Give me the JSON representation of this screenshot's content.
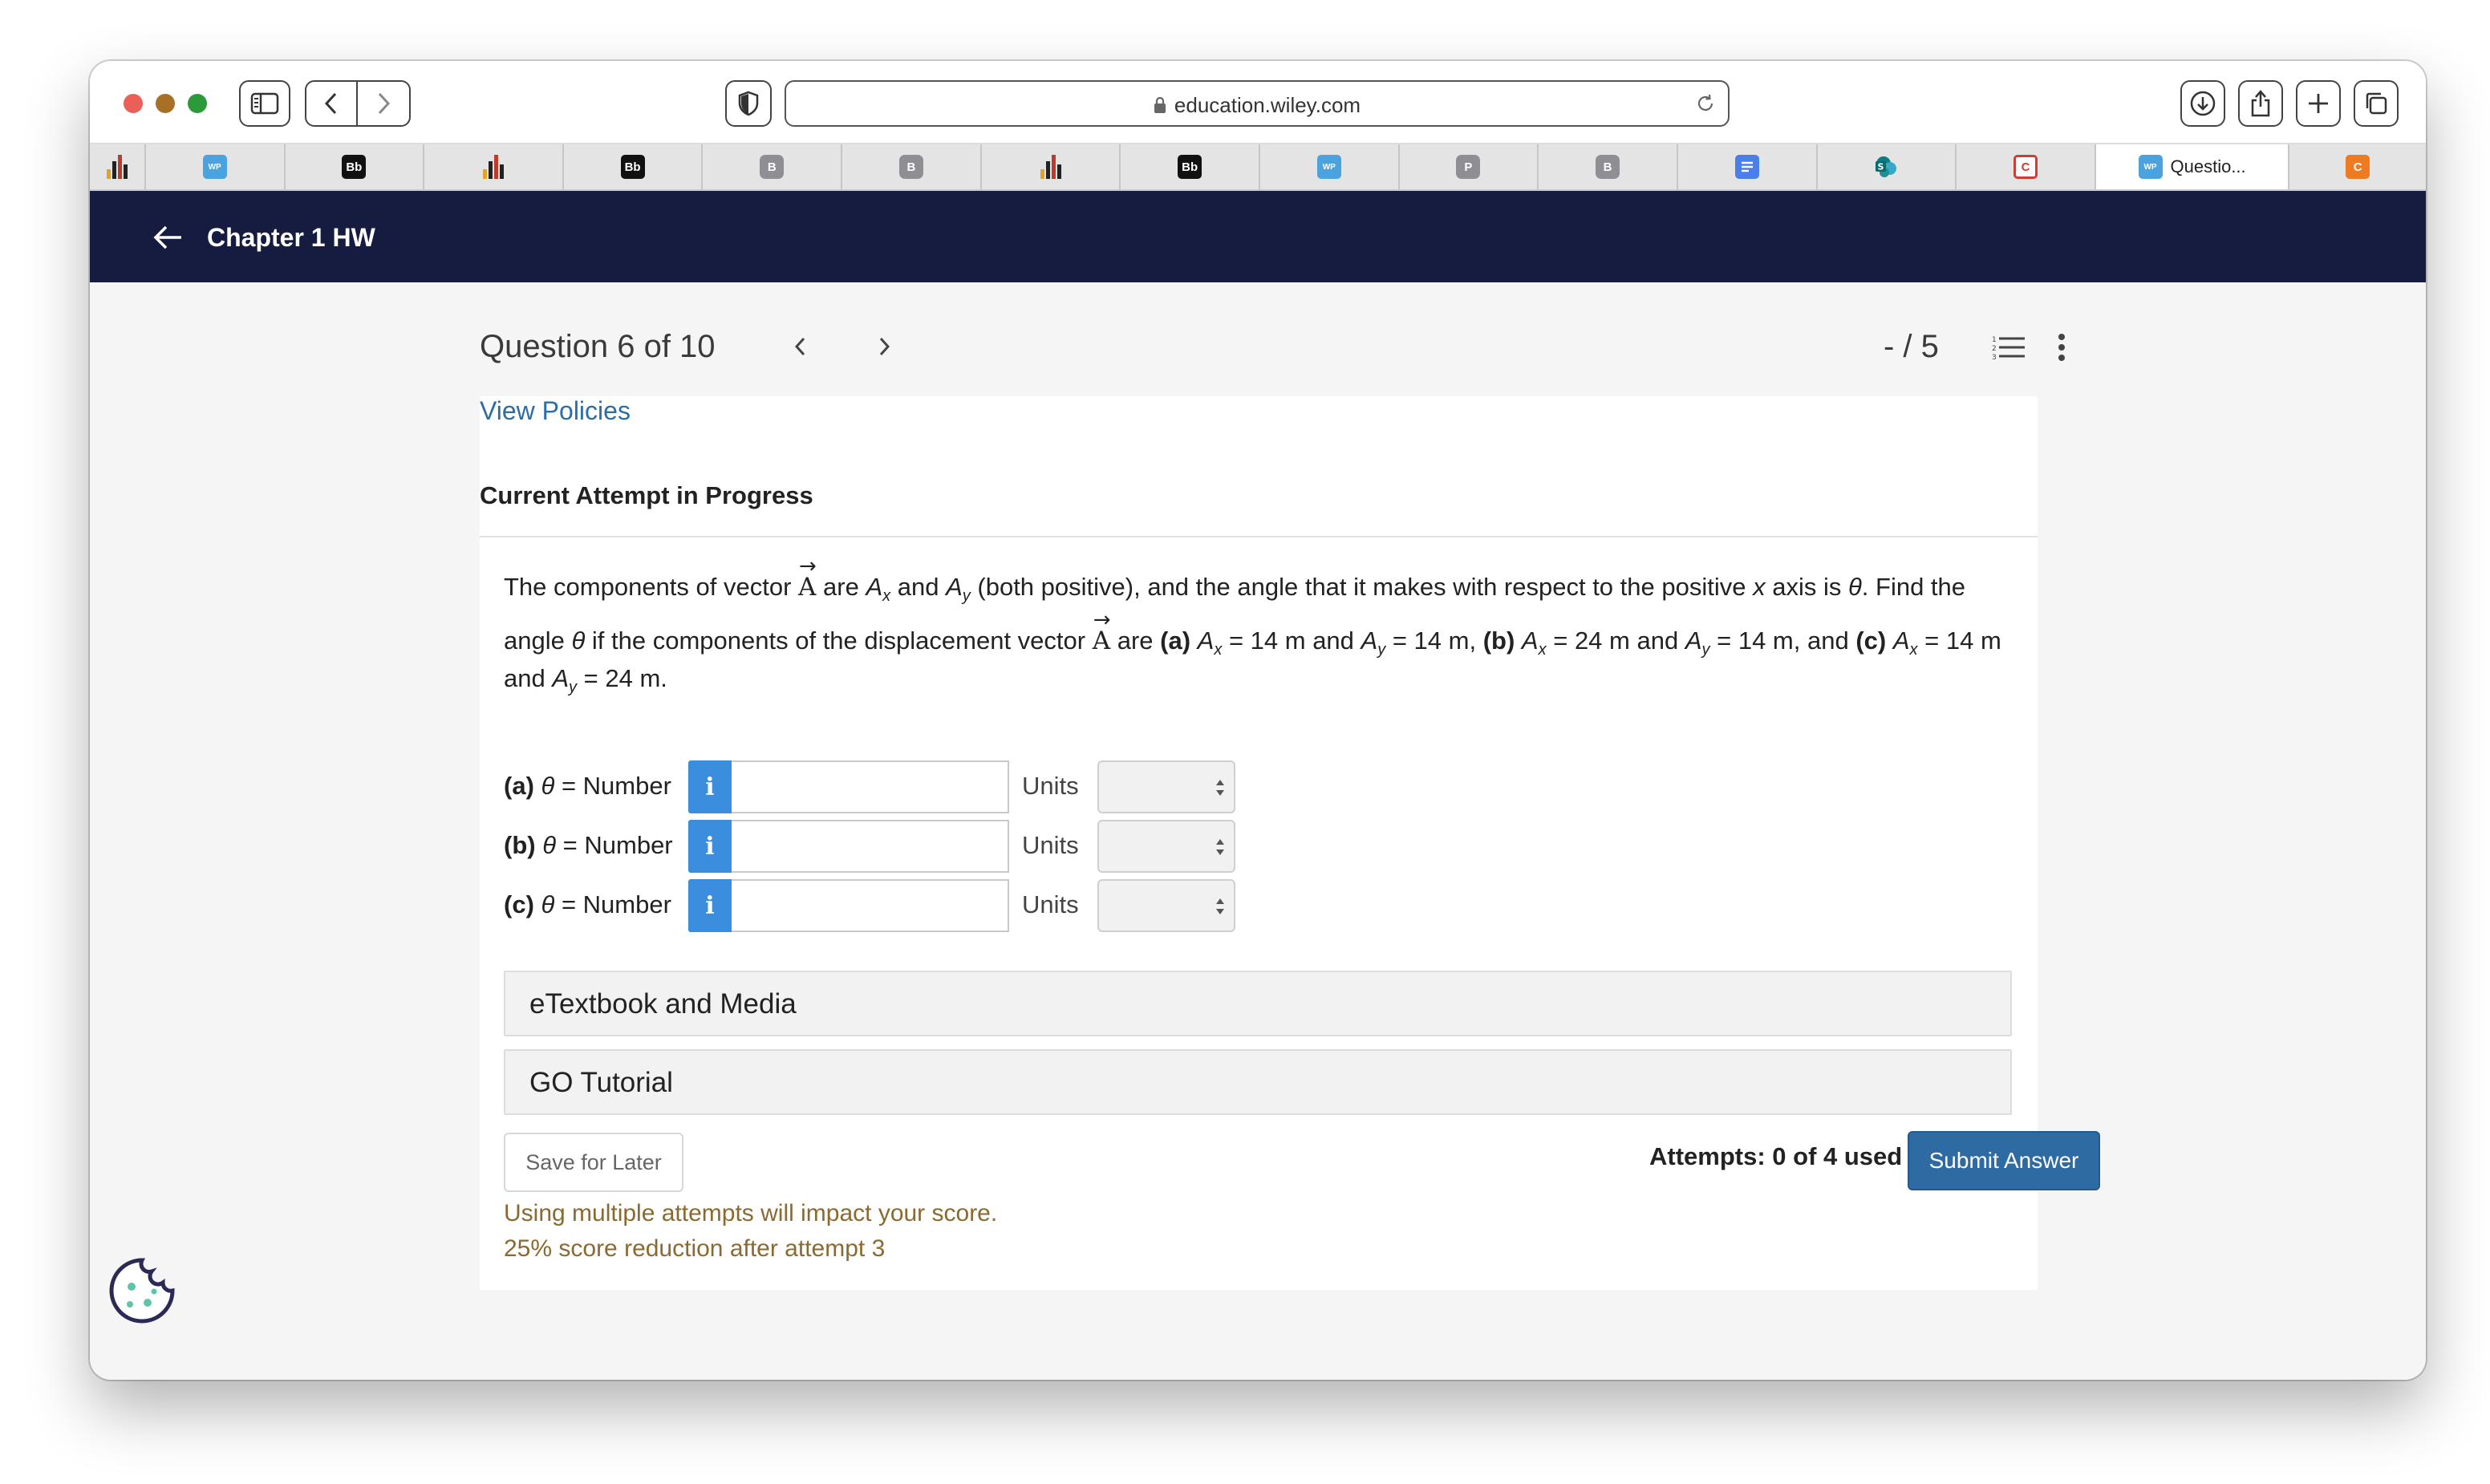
{
  "browser": {
    "url": "education.wiley.com",
    "tabs": [
      {
        "favicon": "bars-icon",
        "label": ""
      },
      {
        "favicon": "WP",
        "label": ""
      },
      {
        "favicon": "Bb",
        "label": ""
      },
      {
        "favicon": "bars-icon",
        "label": ""
      },
      {
        "favicon": "Bb",
        "label": ""
      },
      {
        "favicon": "B",
        "label": ""
      },
      {
        "favicon": "B",
        "label": ""
      },
      {
        "favicon": "bars-icon",
        "label": ""
      },
      {
        "favicon": "Bb",
        "label": ""
      },
      {
        "favicon": "WP",
        "label": ""
      },
      {
        "favicon": "P",
        "label": ""
      },
      {
        "favicon": "B",
        "label": ""
      },
      {
        "favicon": "doc-icon",
        "label": ""
      },
      {
        "favicon": "sharepoint-icon",
        "label": ""
      },
      {
        "favicon": "C",
        "label": ""
      },
      {
        "favicon": "WP",
        "label": "Questio..."
      },
      {
        "favicon": "C",
        "label": ""
      }
    ]
  },
  "header": {
    "title": "Chapter 1 HW"
  },
  "question": {
    "title": "Question 6 of 10",
    "score": "- / 5"
  },
  "content": {
    "view_policies": "View Policies",
    "attempt_status": "Current Attempt in Progress",
    "prompt": {
      "t1": "The components of vector ",
      "vec": "A",
      "t2": " are ",
      "t3": " and ",
      "t4": " (both positive), and the angle that it makes with respect to the positive ",
      "x": "x",
      "t5": " axis is ",
      "theta": "θ",
      "t6": ". Find the",
      "t7": "angle ",
      "t8": " if the components of the displacement vector ",
      "t9": " are ",
      "pa": "(a)",
      "pa_val": " = 14 m and ",
      "pa_val2": " = 14 m, ",
      "pb": "(b)",
      "pb_val": " = 24 m and ",
      "pb_val2": " = 14 m, and ",
      "pc": "(c)",
      "pc_val": " = 14 m",
      "t10": "and ",
      "pc_val2": " = 24 m.",
      "A": "A",
      "sx": "x",
      "sy": "y"
    },
    "answers": [
      {
        "part": "(a)",
        "label": " = Number",
        "value": "",
        "units_label": "Units",
        "units_value": ""
      },
      {
        "part": "(b)",
        "label": " = Number",
        "value": "",
        "units_label": "Units",
        "units_value": ""
      },
      {
        "part": "(c)",
        "label": " = Number",
        "value": "",
        "units_label": "Units",
        "units_value": ""
      }
    ],
    "info_glyph": "i",
    "accordions": [
      "eTextbook and Media",
      "GO Tutorial"
    ],
    "save_label": "Save for Later",
    "attempts_used": "Attempts: 0 of 4 used",
    "submit_label": "Submit Answer",
    "warnings": [
      "Using multiple attempts will impact your score.",
      "25% score reduction after attempt 3"
    ]
  },
  "colors": {
    "header_bg": "#161c40",
    "link": "#2e6da4",
    "info_button": "#3b8ede",
    "submit_button": "#2f6ba3",
    "warning_text": "#8a6a2f"
  }
}
